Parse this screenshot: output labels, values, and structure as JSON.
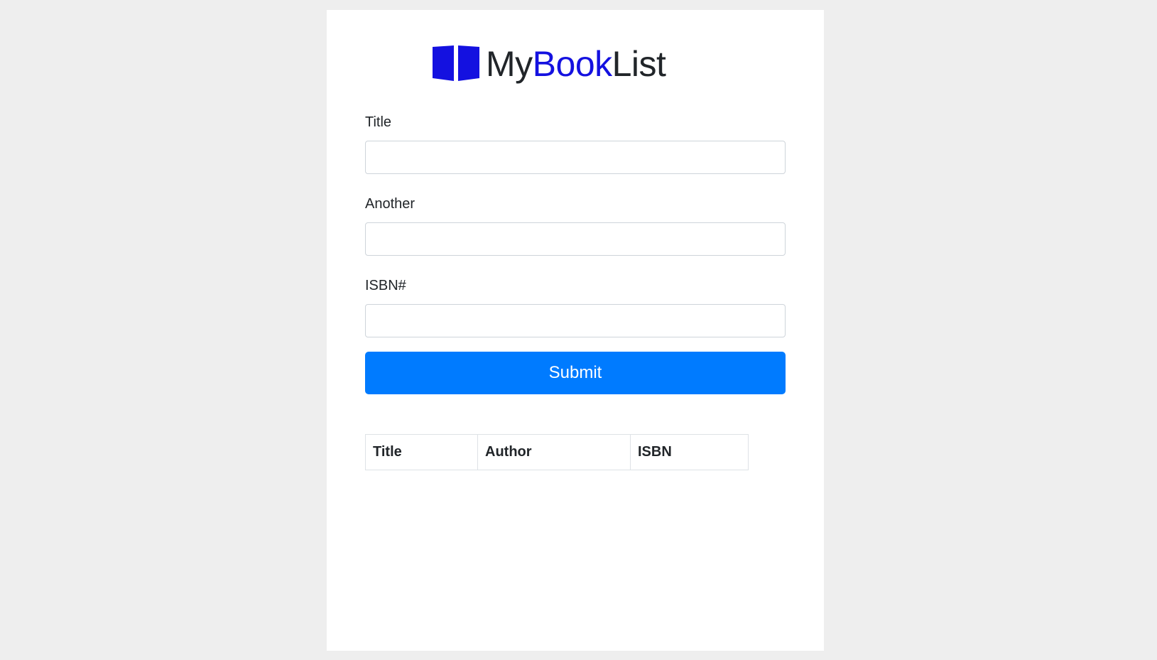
{
  "brand": {
    "part_my": "My",
    "part_book": "Book",
    "part_list": "List",
    "icon": "open-book-icon",
    "accent_color": "#1411e0"
  },
  "form": {
    "title_label": "Title",
    "title_value": "",
    "author_label": "Another",
    "author_value": "",
    "isbn_label": "ISBN#",
    "isbn_value": "",
    "submit_label": "Submit",
    "submit_color": "#007bff"
  },
  "table": {
    "headers": [
      "Title",
      "Author",
      "ISBN"
    ],
    "rows": []
  }
}
